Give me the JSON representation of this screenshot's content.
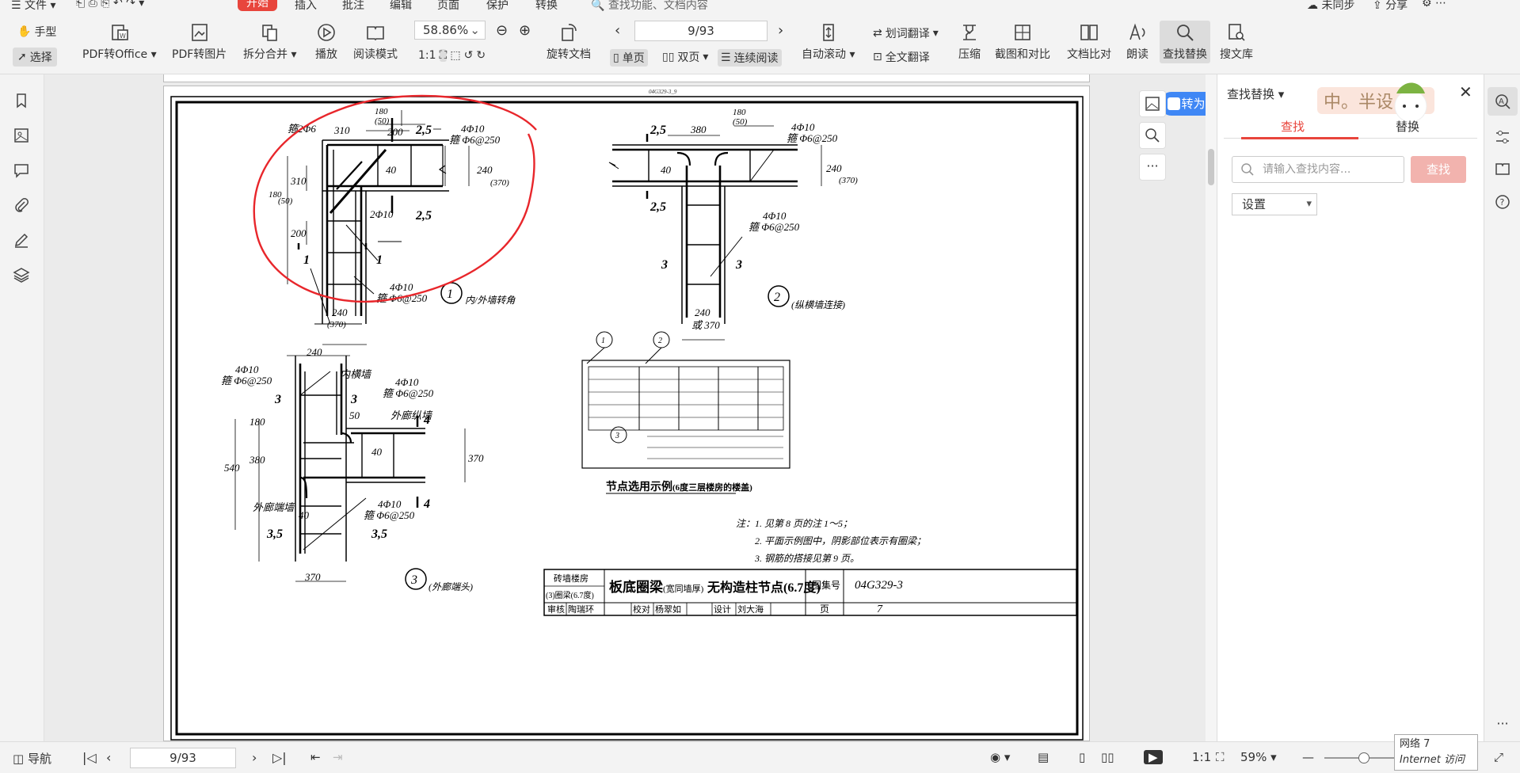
{
  "menubar": {
    "menu_label": "文件",
    "items": [
      "开始",
      "插入",
      "批注",
      "编辑",
      "页面",
      "保护",
      "转换"
    ],
    "search_hint": "查找功能、文档内容",
    "sync": "未同步",
    "share": "分享"
  },
  "ribbon": {
    "hand": "手型",
    "select": "选择",
    "pdf_to_office": "PDF转Office",
    "pdf_to_image": "PDF转图片",
    "split_merge": "拆分合并",
    "play": "播放",
    "read_mode": "阅读模式",
    "zoom": "58.86%",
    "rotate": "旋转文档",
    "page_indicator": "9/93",
    "single": "单页",
    "double": "双页",
    "continuous": "连续阅读",
    "auto_scroll": "自动滚动",
    "word_translate": "划词翻译",
    "full_translate": "全文翻译",
    "compress": "压缩",
    "screenshot_compare": "截图和对比",
    "doc_compare": "文档比对",
    "read_aloud": "朗读",
    "find_replace": "查找替换",
    "search_lib": "搜文库"
  },
  "doc": {
    "to_word": "转为Word",
    "top_code": "04G329-3_9"
  },
  "drawing_text": {
    "detail1": "内/外墙转角",
    "detail2": "纵横墙连接",
    "detail3": "外廊端头",
    "example_title": "节点选用示例",
    "example_sub": "(6度三层楼房的楼盖)",
    "note1": "注：1. 见第 8 页的注 1～5；",
    "note2": "2. 平面示例图中，阴影部位表示有圈梁；",
    "note3": "3. 钢筋的搭接见第 9 页。",
    "tb_cat1": "砖墙楼房",
    "tb_cat2": "(3)圈梁(6.7度)",
    "tb_title": "板底圈梁",
    "tb_title2": "(宽同墙厚)",
    "tb_title3": "无构造柱节点(6.7度)",
    "tb_atlas_label": "图集号",
    "tb_atlas": "04G329-3",
    "tb_page_label": "页",
    "tb_page": "7",
    "tb_row": [
      "审核",
      "陶瑞环",
      "校对",
      "杨翠如",
      "设计",
      "刘大海"
    ],
    "labels": {
      "inner_wall": "内横墙",
      "outer_long": "外廊纵墙",
      "outer_end": "外廊端墙",
      "bar_4phi10": "4Φ10",
      "stirrup": "箍 Φ6@250",
      "bar_2phi10": "2Φ10",
      "bar_2phi6": "箍2Φ6",
      "s25": "2,5",
      "s1": "1",
      "s3": "3",
      "s35": "3,5",
      "s4": "4",
      "d180": "180",
      "d50": "(50)",
      "d310": "310",
      "d200": "200",
      "d240": "240",
      "d370": "(370)",
      "d370b": "370",
      "d380": "380",
      "d40": "40",
      "d540": "540",
      "d50b": "50",
      "or370": "或 370",
      "c1": "1",
      "c2": "2",
      "c3": "3"
    }
  },
  "find_panel": {
    "title": "查找替换",
    "tab_find": "查找",
    "tab_replace": "替换",
    "placeholder": "请输入查找内容...",
    "search_btn": "查找",
    "settings": "设置",
    "sticker_text": "中。半设"
  },
  "statusbar": {
    "nav": "导航",
    "page": "9/93",
    "zoom": "59%",
    "network1": "网络 7",
    "network2": "Internet 访问"
  }
}
